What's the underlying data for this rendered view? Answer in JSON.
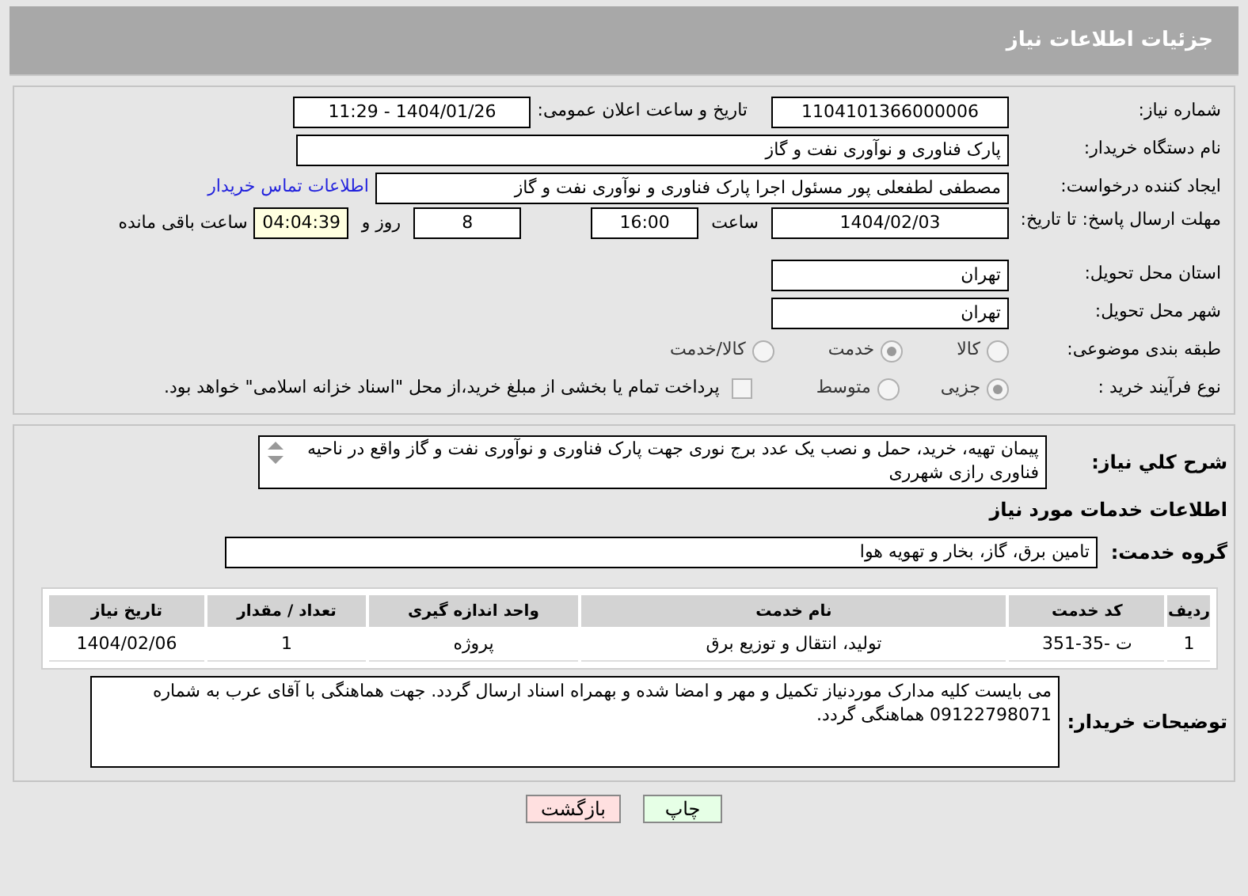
{
  "header": {
    "title": "جزئیات اطلاعات نیاز"
  },
  "need_number": {
    "label": "شماره نیاز:",
    "value": "1104101366000006"
  },
  "announce": {
    "label": "تاریخ و ساعت اعلان عمومی:",
    "value": "1404/01/26 - 11:29"
  },
  "buyer_org": {
    "label": "نام دستگاه خریدار:",
    "value": "پارک فناوری و نوآوری نفت و گاز"
  },
  "requester": {
    "label": "ایجاد کننده درخواست:",
    "value": "مصطفی لطفعلی پور مسئول اجرا پارک فناوری و نوآوری نفت و گاز",
    "link": "اطلاعات تماس خریدار"
  },
  "deadline": {
    "label": "مهلت ارسال پاسخ: تا تاریخ:",
    "date": "1404/02/03",
    "time_label": "ساعت",
    "time": "16:00",
    "days": "8",
    "days_label": "روز و",
    "remaining": "04:04:39",
    "remaining_label": "ساعت باقی مانده"
  },
  "province": {
    "label": "استان محل تحویل:",
    "value": "تهران"
  },
  "city": {
    "label": "شهر محل تحویل:",
    "value": "تهران"
  },
  "category": {
    "label": "طبقه بندی موضوعی:",
    "options": [
      {
        "label": "کالا",
        "selected": false
      },
      {
        "label": "خدمت",
        "selected": true
      },
      {
        "label": "کالا/خدمت",
        "selected": false
      }
    ]
  },
  "process": {
    "label": "نوع فرآیند خرید :",
    "options": [
      {
        "label": "جزیی",
        "selected": true
      },
      {
        "label": "متوسط",
        "selected": false
      }
    ],
    "checkbox": {
      "label": "پرداخت تمام یا بخشی از مبلغ خرید،از محل \"اسناد خزانه اسلامی\" خواهد بود.",
      "checked": false
    }
  },
  "description": {
    "label": "شرح کلي نياز:",
    "value": "پیمان تهیه، خرید، حمل و نصب یک عدد برج نوری جهت پارک فناوری و نوآوری نفت و گاز واقع در ناحیه فناوری رازی شهرری"
  },
  "services_title": "اطلاعات خدمات مورد نياز",
  "service_group": {
    "label": "گروه خدمت:",
    "value": "تامین برق، گاز، بخار و تهویه هوا"
  },
  "table": {
    "columns": [
      "ردیف",
      "کد خدمت",
      "نام خدمت",
      "واحد اندازه گیری",
      "تعداد / مقدار",
      "تاریخ نیاز"
    ],
    "rows": [
      [
        "1",
        "ت -35-351",
        "تولید، انتقال و توزیع برق",
        "پروژه",
        "1",
        "1404/02/06"
      ]
    ]
  },
  "buyer_notes": {
    "label": "توضیحات خریدار:",
    "value": "می بایست کلیه مدارک موردنیاز تکمیل و مهر و امضا شده و بهمراه اسناد ارسال گردد. جهت هماهنگی با آقای عرب به شماره 09122798071 هماهنگی گردد."
  },
  "buttons": [
    {
      "label": "چاپ",
      "kind": "print"
    },
    {
      "label": "بازگشت",
      "kind": "back"
    }
  ]
}
